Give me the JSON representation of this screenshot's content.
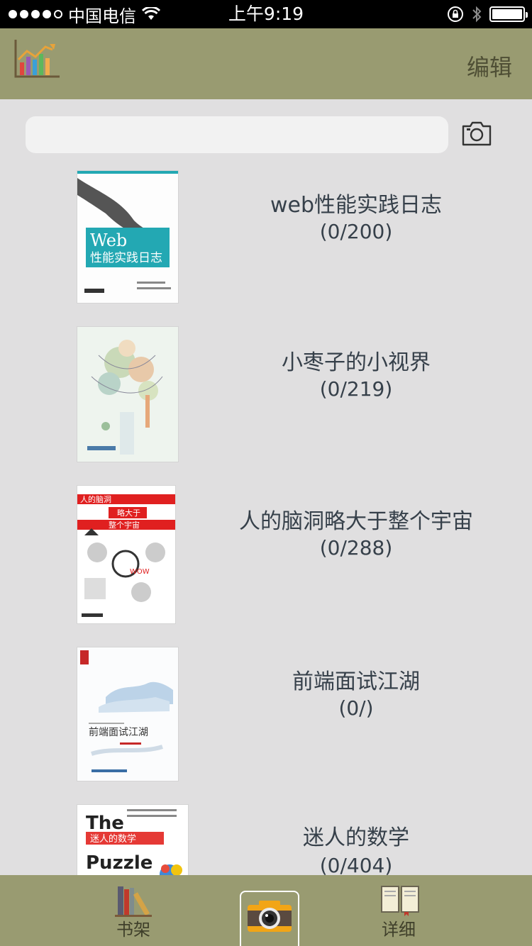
{
  "status_bar": {
    "carrier": "中国电信",
    "time": "上午9:19"
  },
  "nav": {
    "edit_label": "编辑",
    "left_icon": "bar-chart-icon"
  },
  "search": {
    "value": "",
    "placeholder": ""
  },
  "books": [
    {
      "title": "web性能实践日志",
      "progress": "(0/200)"
    },
    {
      "title": "小枣子的小视界",
      "progress": "(0/219)"
    },
    {
      "title": "人的脑洞略大于整个宇宙",
      "progress": "(0/288)"
    },
    {
      "title": "前端面试江湖",
      "progress": "(0/)"
    },
    {
      "title": "迷人的数学",
      "progress": "(0/404)"
    }
  ],
  "covers": {
    "web_line1": "Web",
    "web_line2": "性能实践日志",
    "brain_line1": "人的脑洞",
    "brain_line2": "略大于",
    "brain_line3": "整个宇宙",
    "frontend_title": "前端面试江湖",
    "puzzle_line1": "The",
    "puzzle_line2": "迷人的数学",
    "puzzle_line3": "Puzzle"
  },
  "tabs": [
    {
      "label": "书架",
      "icon": "bookshelf-icon"
    },
    {
      "label": "",
      "icon": "camera-icon"
    },
    {
      "label": "详细",
      "icon": "open-book-icon"
    }
  ],
  "colors": {
    "bar_olive": "#999b71",
    "background": "#e0dfe0",
    "text": "#36404a"
  }
}
